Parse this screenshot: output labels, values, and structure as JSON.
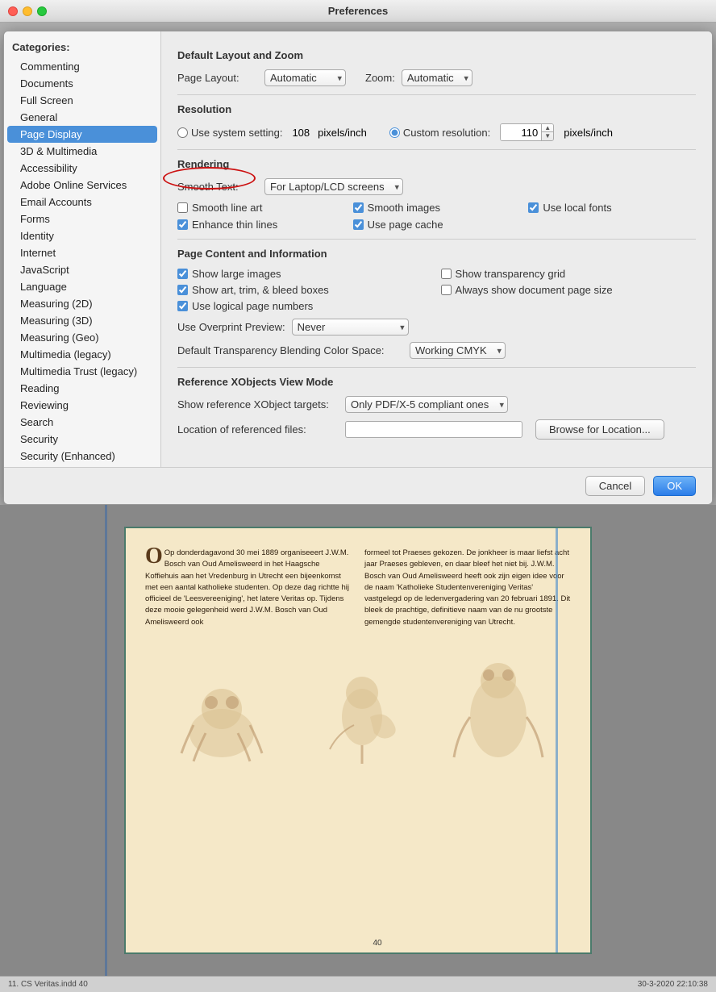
{
  "window": {
    "title": "Preferences"
  },
  "sidebar": {
    "title": "Categories:",
    "items": [
      {
        "label": "Commenting",
        "active": false
      },
      {
        "label": "Documents",
        "active": false
      },
      {
        "label": "Full Screen",
        "active": false
      },
      {
        "label": "General",
        "active": false
      },
      {
        "label": "Page Display",
        "active": true
      },
      {
        "label": "3D & Multimedia",
        "active": false
      },
      {
        "label": "Accessibility",
        "active": false
      },
      {
        "label": "Adobe Online Services",
        "active": false
      },
      {
        "label": "Email Accounts",
        "active": false
      },
      {
        "label": "Forms",
        "active": false
      },
      {
        "label": "Identity",
        "active": false
      },
      {
        "label": "Internet",
        "active": false
      },
      {
        "label": "JavaScript",
        "active": false
      },
      {
        "label": "Language",
        "active": false
      },
      {
        "label": "Measuring (2D)",
        "active": false
      },
      {
        "label": "Measuring (3D)",
        "active": false
      },
      {
        "label": "Measuring (Geo)",
        "active": false
      },
      {
        "label": "Multimedia (legacy)",
        "active": false
      },
      {
        "label": "Multimedia Trust (legacy)",
        "active": false
      },
      {
        "label": "Reading",
        "active": false
      },
      {
        "label": "Reviewing",
        "active": false
      },
      {
        "label": "Search",
        "active": false
      },
      {
        "label": "Security",
        "active": false
      },
      {
        "label": "Security (Enhanced)",
        "active": false
      }
    ]
  },
  "main": {
    "section_layout": "Default Layout and Zoom",
    "layout_label": "Page Layout:",
    "layout_value": "Automatic",
    "zoom_label": "Zoom:",
    "zoom_value": "Automatic",
    "section_resolution": "Resolution",
    "radio_system": "Use system setting:",
    "system_value": "108",
    "pixels_inch": "pixels/inch",
    "radio_custom": "Custom resolution:",
    "custom_value": "110",
    "section_rendering": "Rendering",
    "smooth_text_label": "Smooth Text:",
    "smooth_text_value": "For Laptop/LCD screens",
    "smooth_lineart_label": "Smooth line art",
    "smooth_images_label": "Smooth images",
    "use_local_fonts_label": "Use local fonts",
    "enhance_thin_label": "Enhance thin lines",
    "use_page_cache_label": "Use page cache",
    "section_page_content": "Page Content and Information",
    "show_large_images": "Show large images",
    "show_art_trim": "Show art, trim, & bleed boxes",
    "show_transparency": "Show transparency grid",
    "use_logical": "Use logical page numbers",
    "always_show_doc": "Always show document page size",
    "overprint_label": "Use Overprint Preview:",
    "overprint_value": "Never",
    "transparency_label": "Default Transparency Blending Color Space:",
    "transparency_value": "Working CMYK",
    "section_xobjects": "Reference XObjects View Mode",
    "xobject_label": "Show reference XObject targets:",
    "xobject_value": "Only PDF/X-5 compliant ones",
    "location_label": "Location of referenced files:",
    "location_value": "",
    "browse_button": "Browse for Location...",
    "cancel_button": "Cancel",
    "ok_button": "OK"
  },
  "doc_viewer": {
    "page_number": "40",
    "status_left": "11. CS Veritas.indd  40",
    "status_right": "30-3-2020  22:10:38",
    "text_col1": "Op donderdagavond 30 mei 1889 organiseeert J.W.M. Bosch van Oud Amelisweerd in het Haagsche Koffiehuis aan het Vredenburg in Utrecht een bijeenkomst met een aantal katholieke studenten. Op deze dag richtte hij officieel de 'Leesvereeniging', het latere Veritas op. Tijdens deze mooie gelegenheid werd J.W.M. Bosch van Oud Amelisweerd ook",
    "text_col2": "formeel tot Praeses gekozen. De jonkheer is maar liefst acht jaar Praeses gebleven, en daar bleef het niet bij. J.W.M. Bosch van Oud Amelisweerd heeft ook zijn eigen idee voor de naam 'Katholieke Studentenvereniging Veritas' vastgelegd op de ledenvergadering van 20 februari 1891. Dit bleek de prachtige, definitieve naam van de nu grootste gemengde studentenvereniging van Utrecht."
  }
}
